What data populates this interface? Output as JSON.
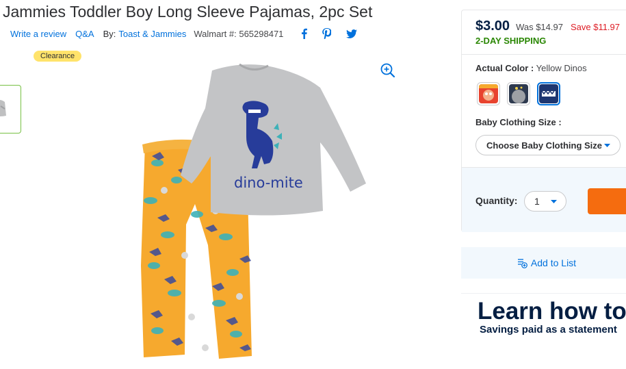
{
  "product": {
    "title": "Jammies Toddler Boy Long Sleeve Pajamas, 2pc Set",
    "write_review": "Write a review",
    "qa": "Q&A",
    "by_label": "By:",
    "brand": "Toast & Jammies",
    "walmart_number": "Walmart #: 565298471",
    "badge": "Clearance",
    "shirt_print": "dino-mite"
  },
  "social": [
    "facebook-icon",
    "pinterest-icon",
    "twitter-icon"
  ],
  "pricing": {
    "price": "$3.00",
    "was": "Was $14.97",
    "save": "Save $11.97",
    "shipping": "2-DAY SHIPPING"
  },
  "options": {
    "color_label": "Actual Color :",
    "color_value": "Yellow Dinos",
    "swatches": [
      "Red pattern",
      "Gray pattern",
      "Navy Yellow Dinos"
    ],
    "selected_swatch": 2,
    "size_label": "Baby Clothing Size :",
    "size_placeholder": "Choose Baby Clothing Size"
  },
  "quantity": {
    "label": "Quantity:",
    "value": "1"
  },
  "list": {
    "label": "Add to List"
  },
  "banner": {
    "headline": "Learn how to",
    "sub": "Savings paid as a statement"
  },
  "colors": {
    "link": "#0071dc",
    "price": "#041e42",
    "save": "#de1c24",
    "shipping": "#2a8703",
    "badge": "#ffe36b",
    "cart": "#f56c0f",
    "panel_tint": "#f2f8fd"
  }
}
